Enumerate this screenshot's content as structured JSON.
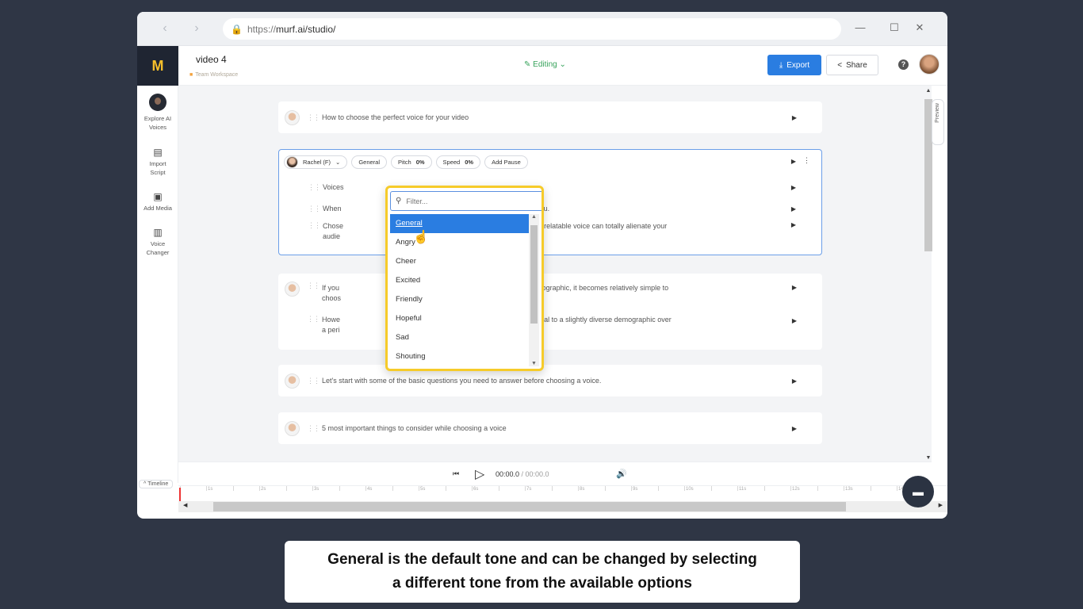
{
  "browser": {
    "back_icon": "chevron-left-icon",
    "forward_icon": "chevron-right-icon",
    "url_scheme": "https://",
    "url_rest": "murf.ai/studio/",
    "minimize": "—",
    "maximize": "☐",
    "close": "✕"
  },
  "header": {
    "logo": "M",
    "title": "video 4",
    "workspace": "Team Workspace",
    "mode": "Editing",
    "export_label": "Export",
    "share_label": "Share",
    "help": "?"
  },
  "sidebar": {
    "items": [
      {
        "label1": "Explore AI",
        "label2": "Voices"
      },
      {
        "label1": "Import",
        "label2": "Script"
      },
      {
        "label1": "Add Media",
        "label2": ""
      },
      {
        "label1": "Voice",
        "label2": "Changer"
      }
    ]
  },
  "blocks": {
    "b1": {
      "text": "How to choose the perfect voice for your video"
    },
    "active": {
      "voice": "Rachel (F)",
      "style": "General",
      "pitch_label": "Pitch",
      "pitch_value": "0%",
      "speed_label": "Speed",
      "speed_value": "0%",
      "pause_label": "Add Pause",
      "rows": [
        {
          "text": "Voices"
        },
        {
          "text": "When                                                          ween your audience and you."
        },
        {
          "text1": "Chose                                                     with your audience, but a non-relatable voice can totally alienate your",
          "text2": "audie"
        }
      ]
    },
    "b3": {
      "rows": [
        {
          "text1": "If you                                                      on or some other specific demographic, it becomes relatively simple to",
          "text2": "choos"
        },
        {
          "text1": "Howe                                                       a brand, that is meant to appeal to a slightly diverse demographic over",
          "text2": "a peri                                                        pe for your video."
        }
      ]
    },
    "b4": {
      "text": "Let's start with some of the basic questions you need to answer before choosing a voice."
    },
    "b5": {
      "text": "5 most important things to consider while choosing a voice"
    }
  },
  "dropdown": {
    "filter_placeholder": "Filter...",
    "options": [
      "General",
      "Angry",
      "Cheer",
      "Excited",
      "Friendly",
      "Hopeful",
      "Sad",
      "Shouting"
    ],
    "selected": "General"
  },
  "preview_label": "Preview",
  "player": {
    "current": "00:00.0",
    "total": " / 00:00.0"
  },
  "timeline": {
    "label": "Timeline",
    "ticks": [
      "1s",
      "2s",
      "3s",
      "4s",
      "5s",
      "6s",
      "7s",
      "8s",
      "9s",
      "10s",
      "11s",
      "12s",
      "13s",
      "14s"
    ]
  },
  "caption": {
    "line1": "General is the default tone and can be changed by selecting",
    "line2": "a different tone from the available options"
  },
  "colors": {
    "accent": "#2a7de1",
    "highlight": "#f6cb2a",
    "editing": "#38a35c"
  }
}
